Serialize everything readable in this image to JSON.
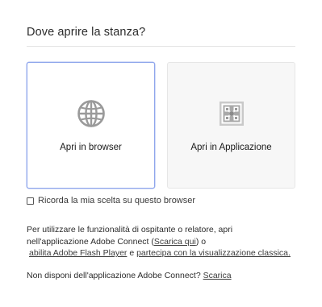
{
  "dialog": {
    "title": "Dove aprire la stanza?",
    "options": [
      {
        "label": "Apri in browser",
        "icon": "globe-icon",
        "selected": true
      },
      {
        "label": "Apri in Applicazione",
        "icon": "adobe-connect-app-icon",
        "selected": false
      }
    ],
    "remember": {
      "label": "Ricorda la mia scelta su questo browser",
      "checked": false
    },
    "info": {
      "line1": "Per utilizzare le funzionalità di ospitante o relatore, apri",
      "line2_prefix": "nell'applicazione Adobe Connect (",
      "download_here_link": "Scarica qui",
      "line2_suffix": ") o",
      "enable_flash_link": "abilita Adobe Flash Player",
      "line3_middle": "e",
      "classic_view_link": "partecipa con la visualizzazione classica."
    },
    "bottom": {
      "text": "Non disponi dell'applicazione Adobe Connect?",
      "download_link": "Scarica"
    }
  },
  "colors": {
    "selected_border": "#8fa6ec",
    "unselected_bg": "#f7f7f7",
    "icon_gray": "#9a9a9a"
  }
}
